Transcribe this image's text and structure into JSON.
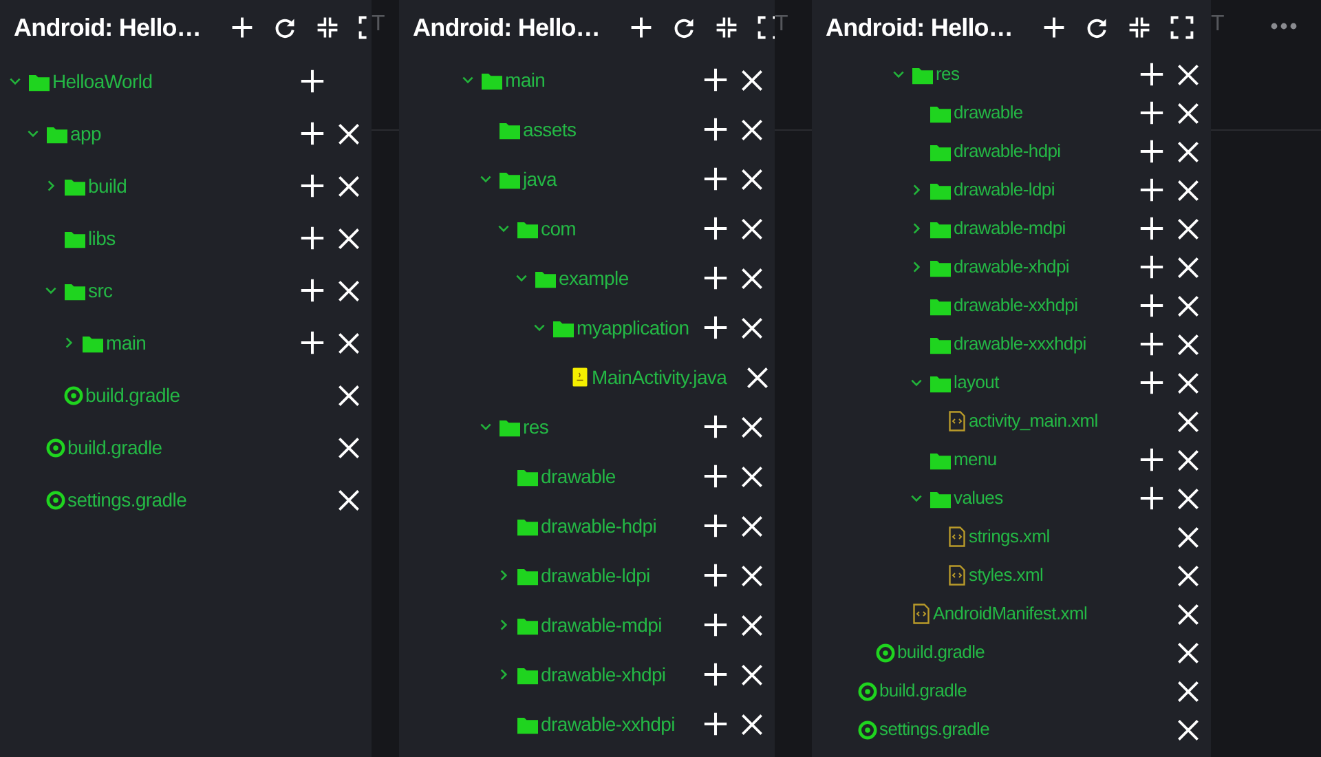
{
  "panels": [
    {
      "title": "Android: Hello…",
      "tab_fragment": "T",
      "tree": [
        {
          "label": "HelloaWorld",
          "kind": "folder",
          "expanded": true,
          "add": true,
          "delete": false,
          "children": [
            {
              "label": "app",
              "kind": "folder",
              "expanded": true,
              "add": true,
              "delete": true,
              "children": [
                {
                  "label": "build",
                  "kind": "folder",
                  "expanded": false,
                  "add": true,
                  "delete": true
                },
                {
                  "label": "libs",
                  "kind": "folder",
                  "add": true,
                  "delete": true
                },
                {
                  "label": "src",
                  "kind": "folder",
                  "expanded": true,
                  "add": true,
                  "delete": true,
                  "children": [
                    {
                      "label": "main",
                      "kind": "folder",
                      "expanded": false,
                      "add": true,
                      "delete": true
                    }
                  ]
                },
                {
                  "label": "build.gradle",
                  "kind": "gradle",
                  "add": false,
                  "delete": true
                }
              ]
            },
            {
              "label": "build.gradle",
              "kind": "gradle",
              "add": false,
              "delete": true
            },
            {
              "label": "settings.gradle",
              "kind": "gradle",
              "add": false,
              "delete": true
            }
          ]
        }
      ]
    },
    {
      "title": "Android: Hello…",
      "tab_fragment": "T",
      "tree": [
        {
          "children": [
            {
              "children": [
                {
                  "children": [
                    {
                      "label": "main",
                      "kind": "folder",
                      "expanded": true,
                      "add": true,
                      "delete": true,
                      "children": [
                        {
                          "label": "assets",
                          "kind": "folder",
                          "add": true,
                          "delete": true
                        },
                        {
                          "label": "java",
                          "kind": "folder",
                          "expanded": true,
                          "add": true,
                          "delete": true,
                          "children": [
                            {
                              "label": "com",
                              "kind": "folder",
                              "expanded": true,
                              "add": true,
                              "delete": true,
                              "children": [
                                {
                                  "label": "example",
                                  "kind": "folder",
                                  "expanded": true,
                                  "add": true,
                                  "delete": true,
                                  "children": [
                                    {
                                      "label": "myapplication",
                                      "kind": "folder",
                                      "expanded": true,
                                      "add": true,
                                      "delete": true,
                                      "children": [
                                        {
                                          "label": "MainActivity.java",
                                          "kind": "java",
                                          "add": false,
                                          "delete": true
                                        }
                                      ]
                                    }
                                  ]
                                }
                              ]
                            }
                          ]
                        },
                        {
                          "label": "res",
                          "kind": "folder",
                          "expanded": true,
                          "add": true,
                          "delete": true,
                          "children": [
                            {
                              "label": "drawable",
                              "kind": "folder",
                              "add": true,
                              "delete": true
                            },
                            {
                              "label": "drawable-hdpi",
                              "kind": "folder",
                              "add": true,
                              "delete": true
                            },
                            {
                              "label": "drawable-ldpi",
                              "kind": "folder",
                              "expanded": false,
                              "add": true,
                              "delete": true
                            },
                            {
                              "label": "drawable-mdpi",
                              "kind": "folder",
                              "expanded": false,
                              "add": true,
                              "delete": true
                            },
                            {
                              "label": "drawable-xhdpi",
                              "kind": "folder",
                              "expanded": false,
                              "add": true,
                              "delete": true
                            },
                            {
                              "label": "drawable-xxhdpi",
                              "kind": "folder",
                              "add": true,
                              "delete": true
                            }
                          ]
                        }
                      ]
                    }
                  ]
                }
              ]
            }
          ]
        }
      ]
    },
    {
      "title": "Android: Hello…",
      "tab_fragment": "T",
      "tree": [
        {
          "children": [
            {
              "children": [
                {
                  "children": [
                    {
                      "children": [
                        {
                          "label": "res",
                          "kind": "folder",
                          "expanded": true,
                          "add": true,
                          "delete": true,
                          "children": [
                            {
                              "label": "drawable",
                              "kind": "folder",
                              "add": true,
                              "delete": true
                            },
                            {
                              "label": "drawable-hdpi",
                              "kind": "folder",
                              "add": true,
                              "delete": true
                            },
                            {
                              "label": "drawable-ldpi",
                              "kind": "folder",
                              "expanded": false,
                              "add": true,
                              "delete": true
                            },
                            {
                              "label": "drawable-mdpi",
                              "kind": "folder",
                              "expanded": false,
                              "add": true,
                              "delete": true
                            },
                            {
                              "label": "drawable-xhdpi",
                              "kind": "folder",
                              "expanded": false,
                              "add": true,
                              "delete": true
                            },
                            {
                              "label": "drawable-xxhdpi",
                              "kind": "folder",
                              "add": true,
                              "delete": true
                            },
                            {
                              "label": "drawable-xxxhdpi",
                              "kind": "folder",
                              "add": true,
                              "delete": true
                            },
                            {
                              "label": "layout",
                              "kind": "folder",
                              "expanded": true,
                              "add": true,
                              "delete": true,
                              "children": [
                                {
                                  "label": "activity_main.xml",
                                  "kind": "xml",
                                  "add": false,
                                  "delete": true
                                }
                              ]
                            },
                            {
                              "label": "menu",
                              "kind": "folder",
                              "add": true,
                              "delete": true
                            },
                            {
                              "label": "values",
                              "kind": "folder",
                              "expanded": true,
                              "add": true,
                              "delete": true,
                              "children": [
                                {
                                  "label": "strings.xml",
                                  "kind": "xml",
                                  "add": false,
                                  "delete": true
                                },
                                {
                                  "label": "styles.xml",
                                  "kind": "xml",
                                  "add": false,
                                  "delete": true
                                }
                              ]
                            }
                          ]
                        },
                        {
                          "label": "AndroidManifest.xml",
                          "kind": "xml",
                          "add": false,
                          "delete": true
                        }
                      ]
                    }
                  ]
                },
                {
                  "label": "build.gradle",
                  "kind": "gradle",
                  "add": false,
                  "delete": true
                }
              ]
            },
            {
              "label": "build.gradle",
              "kind": "gradle",
              "add": false,
              "delete": true
            },
            {
              "label": "settings.gradle",
              "kind": "gradle",
              "add": false,
              "delete": true
            }
          ]
        }
      ]
    }
  ]
}
